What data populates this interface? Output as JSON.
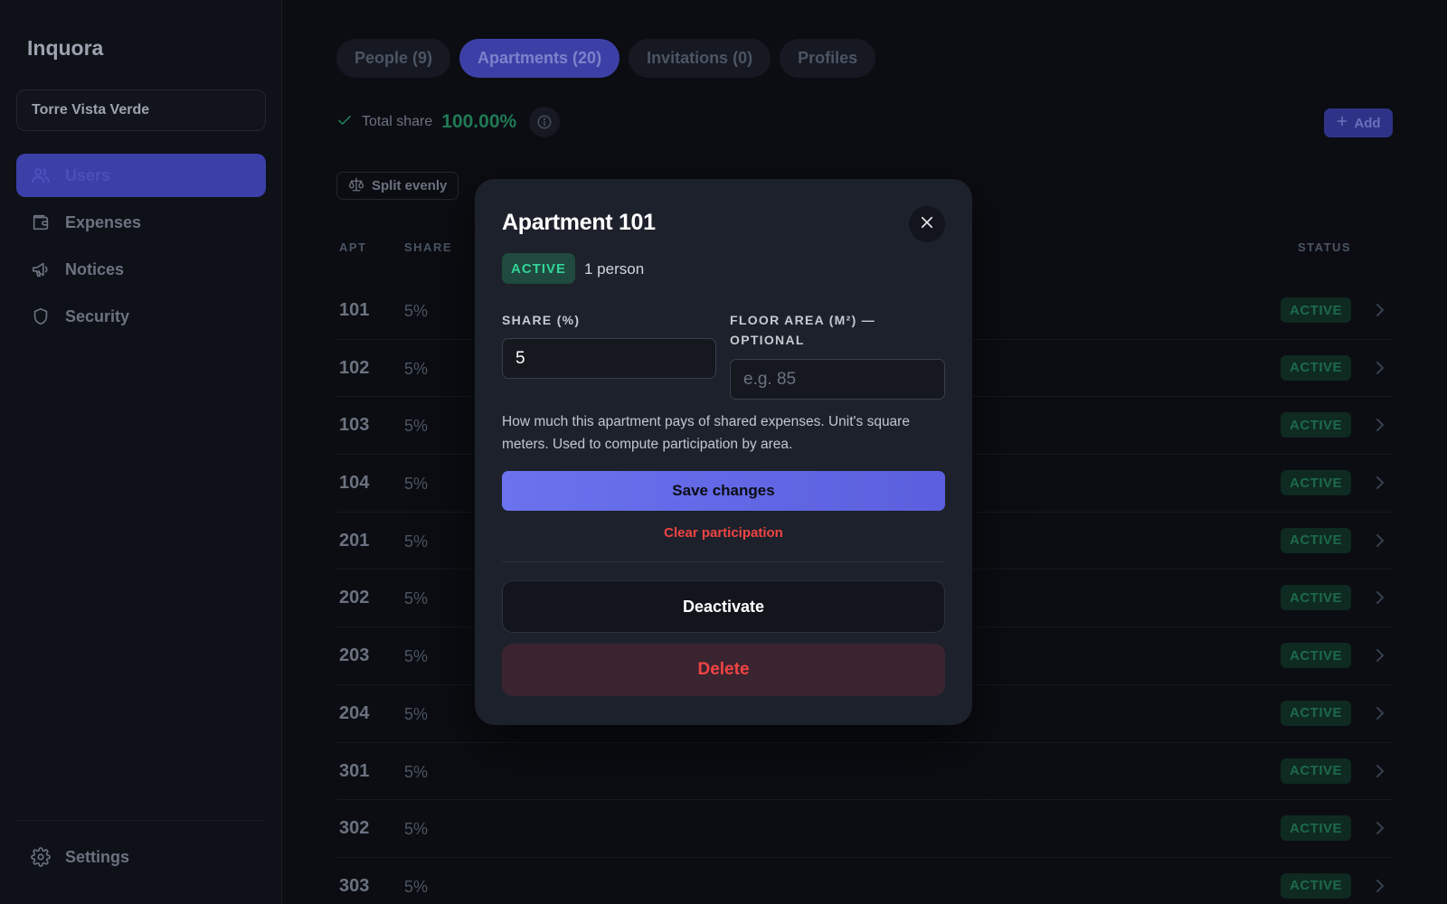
{
  "app": {
    "brand": "Inquora",
    "workspace": "Torre Vista Verde"
  },
  "sidebar": {
    "items": [
      {
        "label": "Users",
        "icon": "users-icon",
        "active": true
      },
      {
        "label": "Expenses",
        "icon": "wallet-icon",
        "active": false
      },
      {
        "label": "Notices",
        "icon": "megaphone-icon",
        "active": false
      },
      {
        "label": "Security",
        "icon": "shield-icon",
        "active": false
      }
    ],
    "settings_label": "Settings"
  },
  "tabs": [
    {
      "label": "People (9)",
      "active": false
    },
    {
      "label": "Apartments (20)",
      "active": true
    },
    {
      "label": "Invitations (0)",
      "active": false
    },
    {
      "label": "Profiles",
      "active": false
    }
  ],
  "summary": {
    "total_label": "Total share",
    "total_value": "100.00%"
  },
  "toolbar": {
    "add_label": "Add",
    "split_label": "Split evenly"
  },
  "table": {
    "headers": {
      "apt": "APT",
      "share": "SHARE",
      "status": "STATUS"
    },
    "rows": [
      {
        "apt": "101",
        "share": "5%",
        "status": "ACTIVE"
      },
      {
        "apt": "102",
        "share": "5%",
        "status": "ACTIVE"
      },
      {
        "apt": "103",
        "share": "5%",
        "status": "ACTIVE"
      },
      {
        "apt": "104",
        "share": "5%",
        "status": "ACTIVE"
      },
      {
        "apt": "201",
        "share": "5%",
        "status": "ACTIVE"
      },
      {
        "apt": "202",
        "share": "5%",
        "status": "ACTIVE"
      },
      {
        "apt": "203",
        "share": "5%",
        "status": "ACTIVE"
      },
      {
        "apt": "204",
        "share": "5%",
        "status": "ACTIVE"
      },
      {
        "apt": "301",
        "share": "5%",
        "status": "ACTIVE"
      },
      {
        "apt": "302",
        "share": "5%",
        "status": "ACTIVE"
      },
      {
        "apt": "303",
        "share": "5%",
        "status": "ACTIVE"
      }
    ]
  },
  "modal": {
    "title": "Apartment 101",
    "status": "ACTIVE",
    "people": "1 person",
    "share_label": "SHARE (%)",
    "share_value": "5",
    "area_label_line1": "FLOOR AREA (M²) —",
    "area_label_line2": "OPTIONAL",
    "area_placeholder": "e.g. 85",
    "help": "How much this apartment pays of shared expenses. Unit's square meters. Used to compute participation by area.",
    "save_label": "Save changes",
    "clear_label": "Clear participation",
    "deactivate_label": "Deactivate",
    "delete_label": "Delete"
  },
  "colors": {
    "accent": "#6366f1",
    "success": "#34d399",
    "danger": "#ef4444",
    "background": "#0b0d12"
  }
}
